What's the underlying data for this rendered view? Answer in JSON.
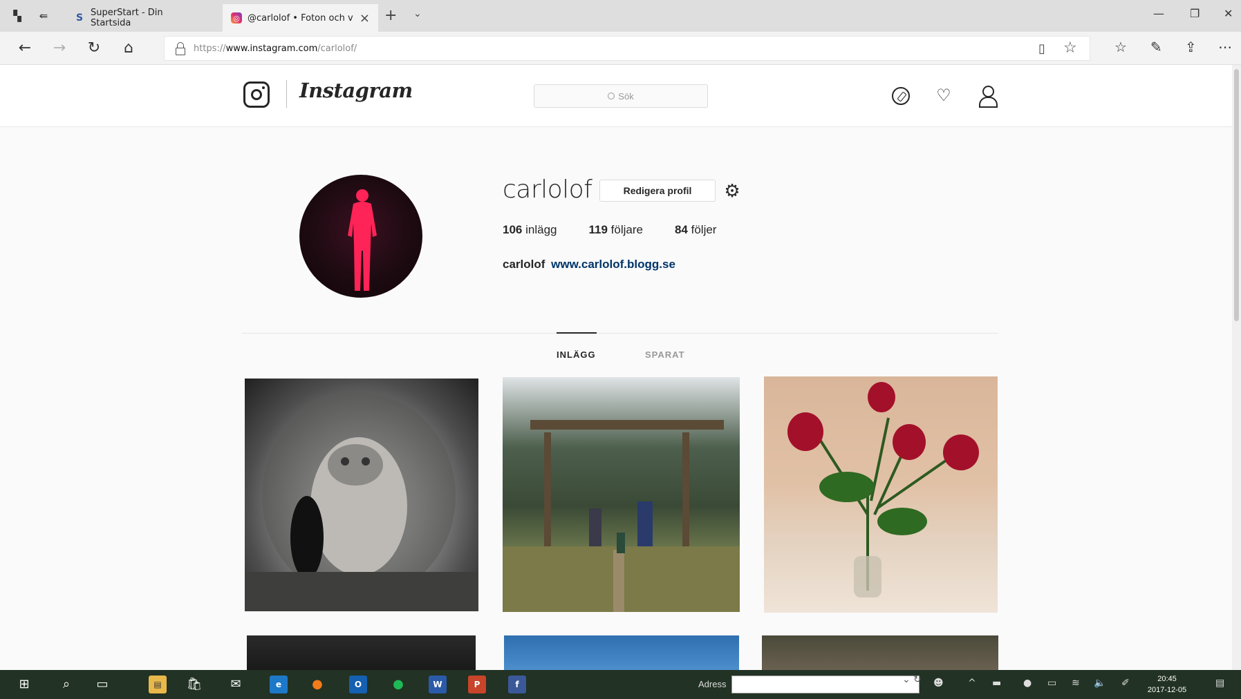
{
  "browser": {
    "tabs": [
      {
        "label": "SuperStart - Din Startsida",
        "favicon": "S"
      },
      {
        "label": "@carlolof • Foton och v",
        "favicon": "instagram"
      }
    ],
    "url": {
      "scheme": "https://",
      "host": "www.instagram.com",
      "path": "/carlolof/"
    }
  },
  "instagram": {
    "brand": "Instagram",
    "search_placeholder": "Sök"
  },
  "profile": {
    "username": "carlolof",
    "edit_label": "Redigera profil",
    "stats": {
      "posts": {
        "count": "106",
        "label": "inlägg"
      },
      "followers": {
        "count": "119",
        "label": "följare"
      },
      "following": {
        "count": "84",
        "label": "följer"
      }
    },
    "bio": {
      "name": "carlolof",
      "link": "www.carlolof.blogg.se"
    },
    "tabs": {
      "posts": "INLÄGG",
      "saved": "SPARAT"
    }
  },
  "taskbar": {
    "address_label": "Adress",
    "clock": {
      "time": "20:45",
      "date": "2017-12-05"
    }
  },
  "colors": {
    "link": "#003569",
    "text": "#262626",
    "avatar_figure": "#ff2457"
  }
}
